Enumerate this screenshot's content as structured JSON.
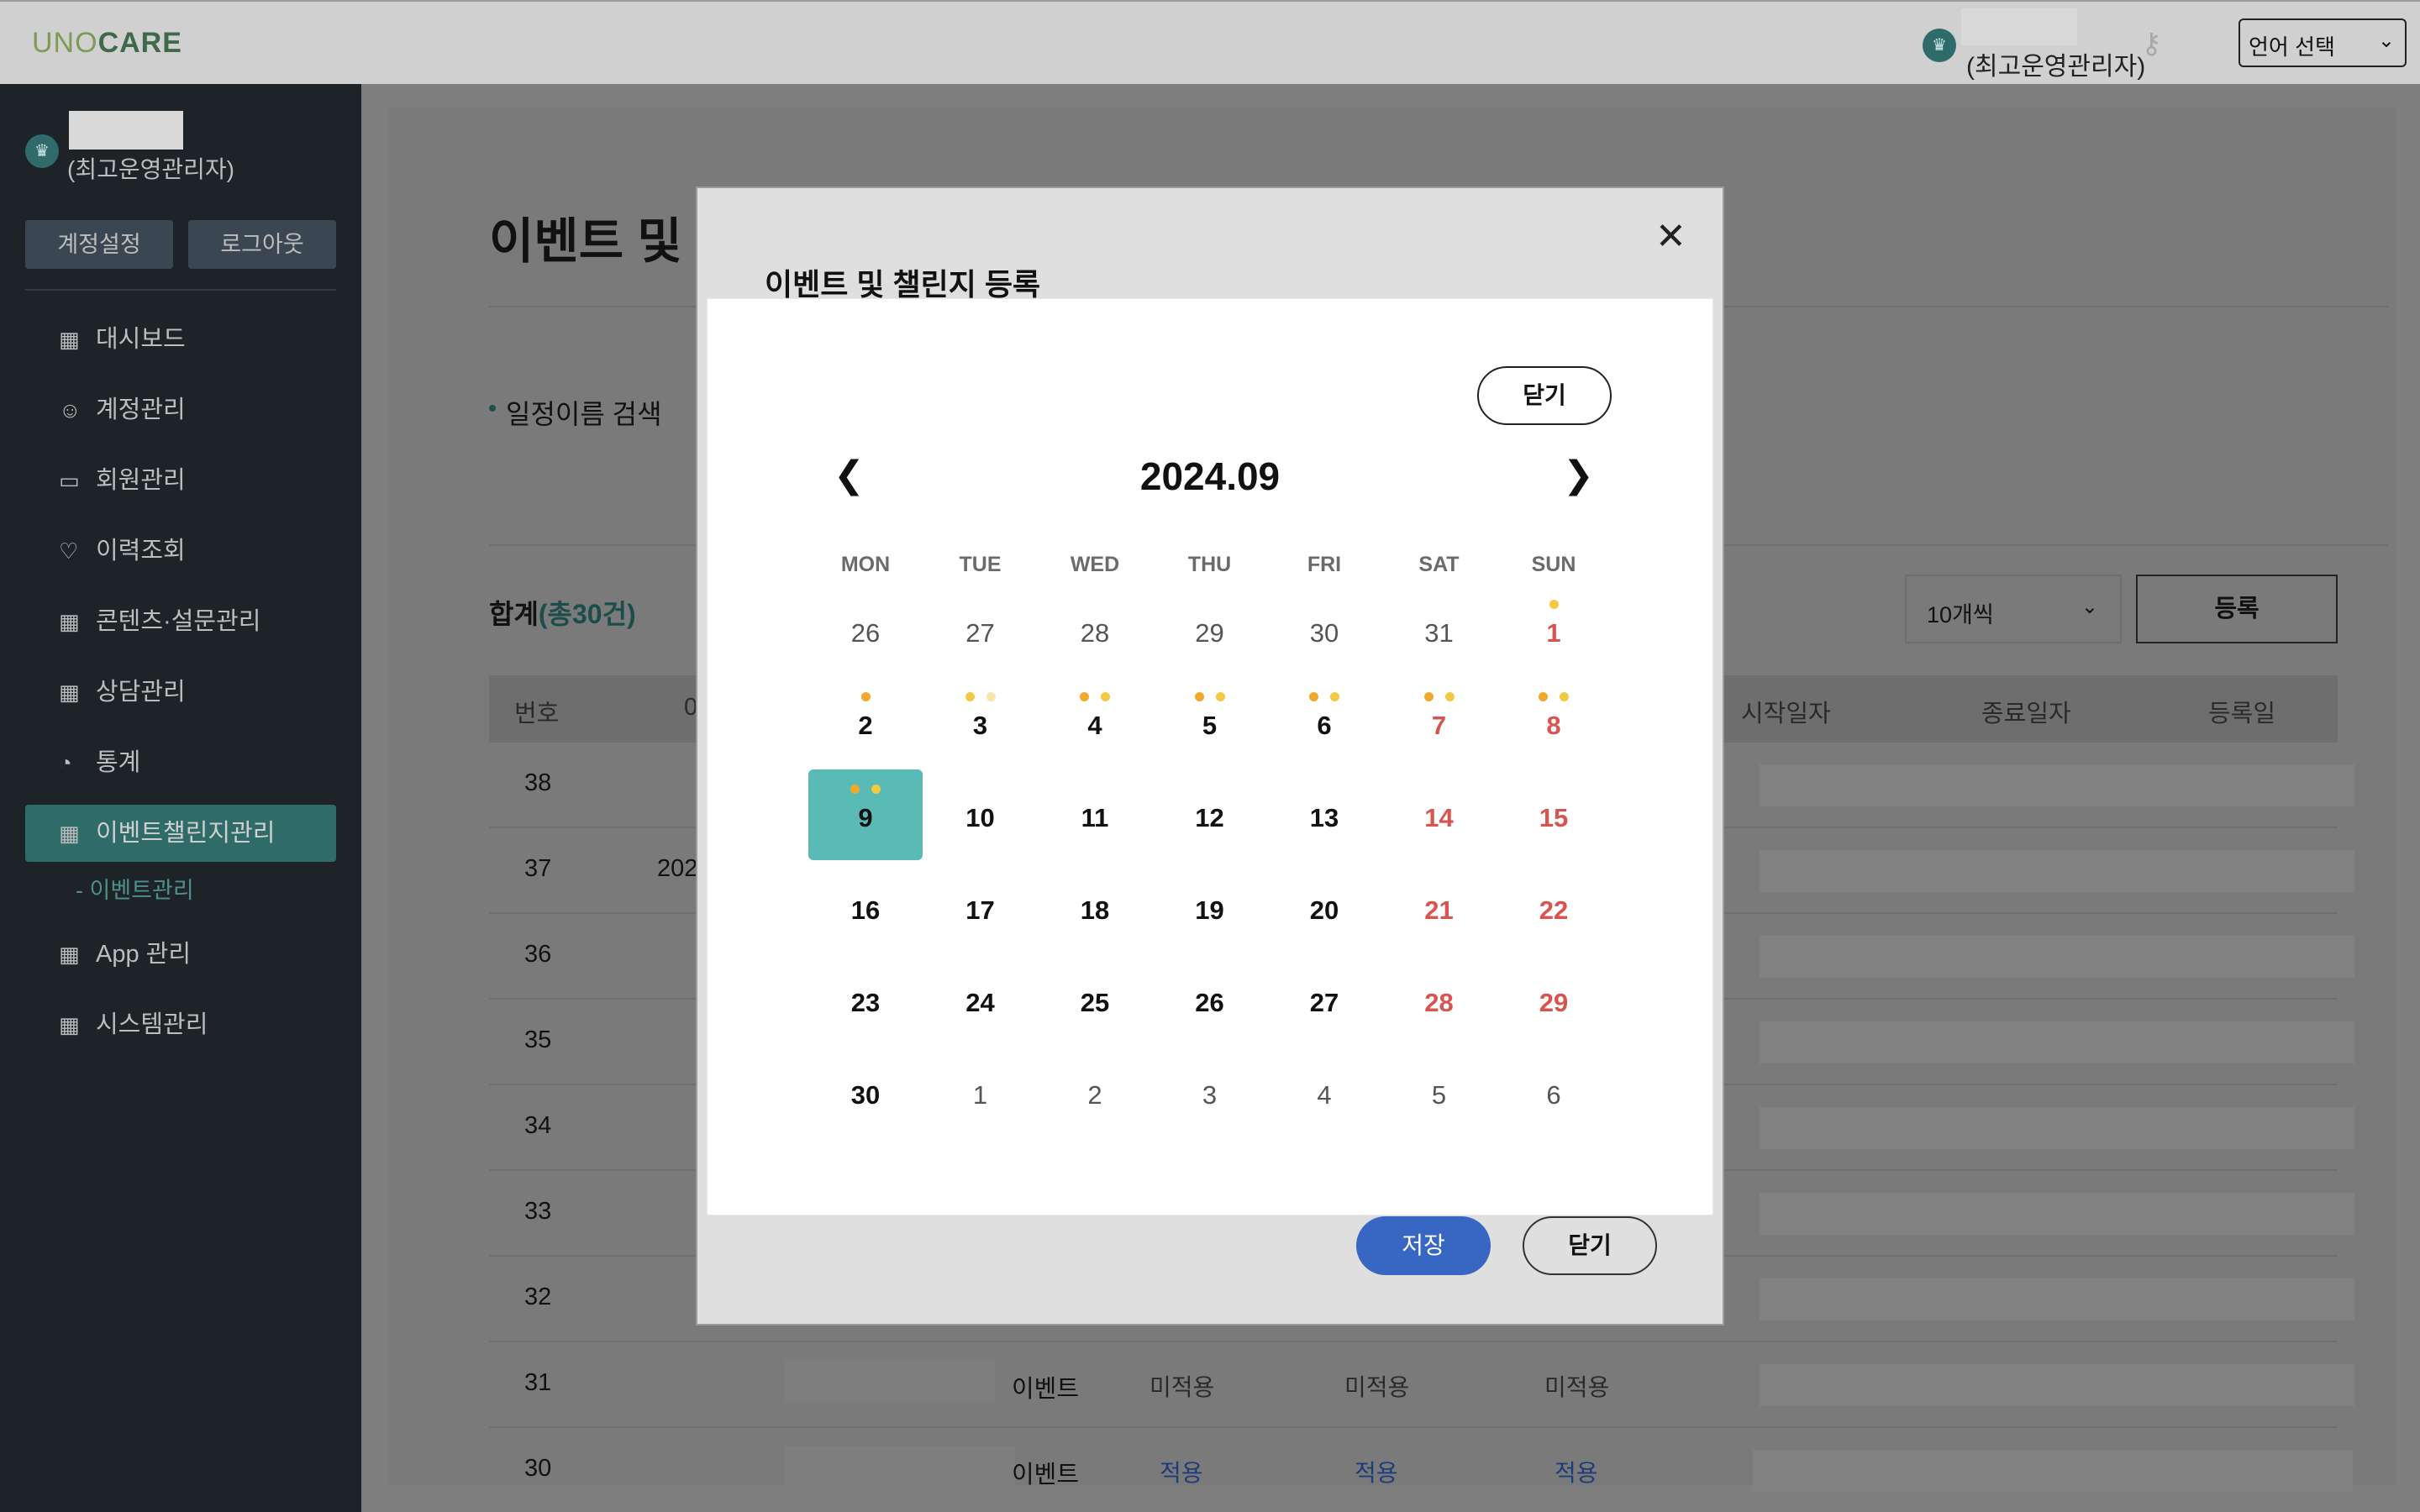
{
  "app": {
    "logo_part1": "UNO",
    "logo_part2": "CARE"
  },
  "topbar": {
    "user_role": "(최고운영관리자)",
    "lang_label": "언어 선택"
  },
  "sidebar": {
    "user_role": "(최고운영관리자)",
    "account_btn": "계정설정",
    "logout_btn": "로그아웃",
    "menu": [
      {
        "label": "대시보드",
        "icon": "grid-icon"
      },
      {
        "label": "계정관리",
        "icon": "smile-icon"
      },
      {
        "label": "회원관리",
        "icon": "folder-icon"
      },
      {
        "label": "이력조회",
        "icon": "heart-icon"
      },
      {
        "label": "콘텐츠·설문관리",
        "icon": "grid-icon"
      },
      {
        "label": "상담관리",
        "icon": "grid-icon"
      },
      {
        "label": "통계",
        "icon": "chart-icon"
      },
      {
        "label": "이벤트챌린지관리",
        "icon": "grid-icon"
      },
      {
        "label": "App 관리",
        "icon": "grid-icon"
      },
      {
        "label": "시스템관리",
        "icon": "grid-icon"
      }
    ],
    "submenu": "- 이벤트관리"
  },
  "main": {
    "title": "이벤트 및",
    "search_label": "일정이름 검색",
    "total_label": "합계",
    "total_count": "(총30건)",
    "per_page": "10개씩",
    "register_btn": "등록",
    "headers": [
      "번호",
      "0",
      "시작일자",
      "종료일자",
      "등록일"
    ],
    "rows": [
      {
        "num": "38"
      },
      {
        "num": "37",
        "c1": "202"
      },
      {
        "num": "36"
      },
      {
        "num": "35"
      },
      {
        "num": "34"
      },
      {
        "num": "33"
      },
      {
        "num": "32"
      },
      {
        "num": "31",
        "category": "이벤트",
        "s1": "미적용",
        "s2": "미적용",
        "s3": "미적용"
      },
      {
        "num": "30",
        "category": "이벤트",
        "s1": "적용",
        "s2": "적용",
        "s3": "적용"
      }
    ]
  },
  "modal": {
    "title": "이벤트 및 챌린지 등록",
    "save_btn": "저장",
    "close_btn": "닫기"
  },
  "calendar": {
    "close_btn": "닫기",
    "prev": "❮",
    "next": "❯",
    "month": "2024.09",
    "weekdays": [
      "MON",
      "TUE",
      "WED",
      "THU",
      "FRI",
      "SAT",
      "SUN"
    ],
    "dot_colors": {
      "orange": "#f0a92a",
      "yellow": "#f5d25a",
      "light": "#f6e7a9"
    },
    "selected_color": "#5abbb6",
    "weeks": [
      [
        {
          "d": "26",
          "o": true
        },
        {
          "d": "27",
          "o": true
        },
        {
          "d": "28",
          "o": true
        },
        {
          "d": "29",
          "o": true
        },
        {
          "d": "30",
          "o": true
        },
        {
          "d": "31",
          "o": true
        },
        {
          "d": "1",
          "w": true,
          "dots": [
            "#f5c842"
          ]
        }
      ],
      [
        {
          "d": "2",
          "dots": [
            "#f0a92a"
          ]
        },
        {
          "d": "3",
          "dots": [
            "#f5c842",
            "#f6e7a9"
          ]
        },
        {
          "d": "4",
          "dots": [
            "#f0a92a",
            "#f5c842"
          ]
        },
        {
          "d": "5",
          "dots": [
            "#f0a92a",
            "#f5c842"
          ]
        },
        {
          "d": "6",
          "dots": [
            "#f0a92a",
            "#f5c842"
          ]
        },
        {
          "d": "7",
          "w": true,
          "dots": [
            "#f0a92a",
            "#f5c842"
          ]
        },
        {
          "d": "8",
          "w": true,
          "dots": [
            "#f0a92a",
            "#f5c842"
          ]
        }
      ],
      [
        {
          "d": "9",
          "sel": true,
          "dots": [
            "#f0a92a",
            "#f5c842"
          ]
        },
        {
          "d": "10"
        },
        {
          "d": "11"
        },
        {
          "d": "12"
        },
        {
          "d": "13"
        },
        {
          "d": "14",
          "w": true
        },
        {
          "d": "15",
          "w": true
        }
      ],
      [
        {
          "d": "16"
        },
        {
          "d": "17"
        },
        {
          "d": "18"
        },
        {
          "d": "19"
        },
        {
          "d": "20"
        },
        {
          "d": "21",
          "w": true
        },
        {
          "d": "22",
          "w": true
        }
      ],
      [
        {
          "d": "23"
        },
        {
          "d": "24"
        },
        {
          "d": "25"
        },
        {
          "d": "26"
        },
        {
          "d": "27"
        },
        {
          "d": "28",
          "w": true
        },
        {
          "d": "29",
          "w": true
        }
      ],
      [
        {
          "d": "30"
        },
        {
          "d": "1",
          "o": true
        },
        {
          "d": "2",
          "o": true
        },
        {
          "d": "3",
          "o": true
        },
        {
          "d": "4",
          "o": true
        },
        {
          "d": "5",
          "o": true
        },
        {
          "d": "6",
          "o": true
        }
      ]
    ]
  }
}
